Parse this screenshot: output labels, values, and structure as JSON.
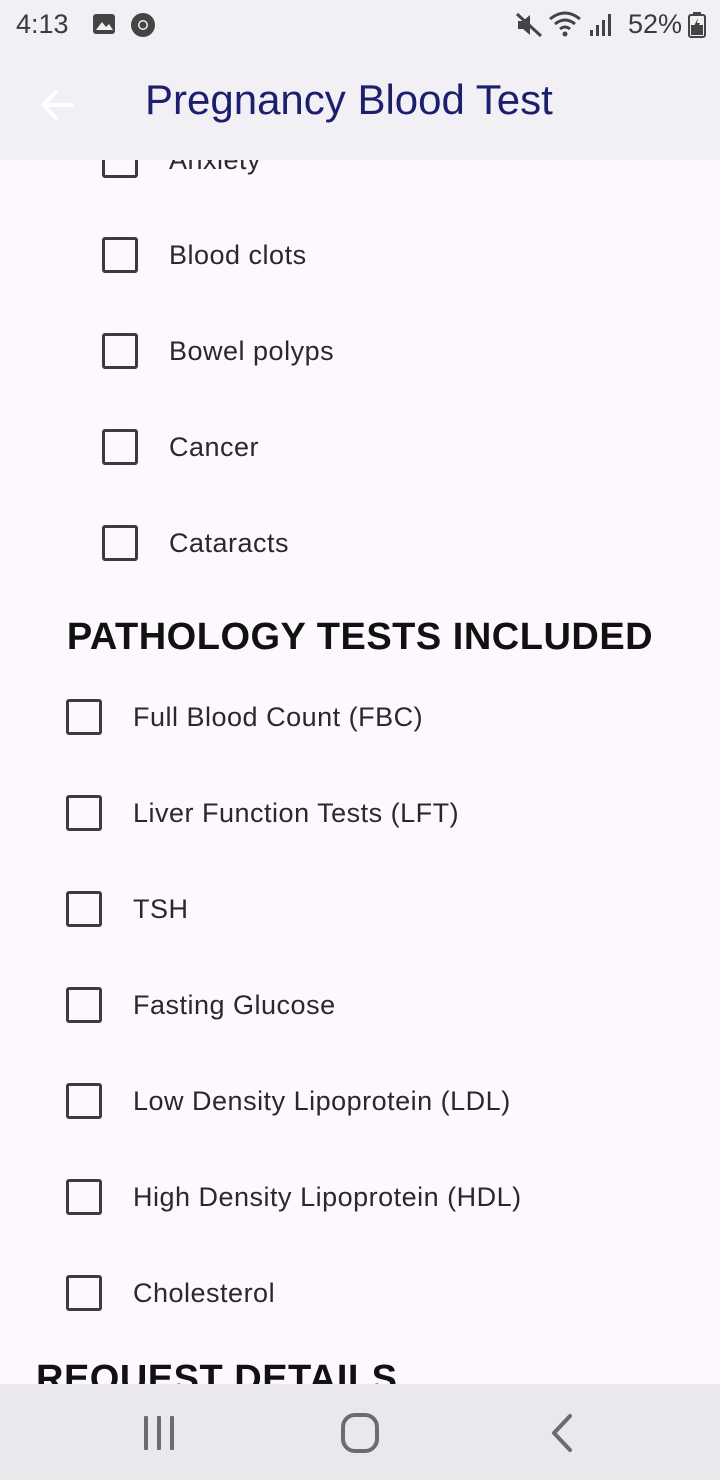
{
  "status_bar": {
    "time": "4:13",
    "battery": "52%",
    "icons": [
      "gallery-icon",
      "chrome-icon",
      "mute-icon",
      "wifi-icon",
      "signal-icon",
      "battery-icon"
    ]
  },
  "app_bar": {
    "title": "Pregnancy Blood Test",
    "back_icon": "arrow-left-icon"
  },
  "conditions": {
    "items": [
      {
        "label": "Anxiety",
        "checked": false
      },
      {
        "label": "Blood clots",
        "checked": false
      },
      {
        "label": "Bowel polyps",
        "checked": false
      },
      {
        "label": "Cancer",
        "checked": false
      },
      {
        "label": "Cataracts",
        "checked": false
      }
    ]
  },
  "pathology": {
    "heading": "PATHOLOGY TESTS INCLUDED",
    "items": [
      {
        "label": "Full Blood Count (FBC)",
        "checked": false
      },
      {
        "label": "Liver Function Tests (LFT)",
        "checked": false
      },
      {
        "label": "TSH",
        "checked": false
      },
      {
        "label": "Fasting Glucose",
        "checked": false
      },
      {
        "label": "Low Density Lipoprotein (LDL)",
        "checked": false
      },
      {
        "label": "High Density Lipoprotein (HDL)",
        "checked": false
      },
      {
        "label": "Cholesterol",
        "checked": false
      }
    ]
  },
  "request_details": {
    "heading": "REQUEST DETAILS"
  },
  "nav_bar": {
    "icons": [
      "recent-apps-icon",
      "home-icon",
      "back-nav-icon"
    ]
  },
  "colors": {
    "title": "#1c1f6e",
    "app_bar_bg": "#f2eff5",
    "page_bg": "#fdf8fd"
  }
}
